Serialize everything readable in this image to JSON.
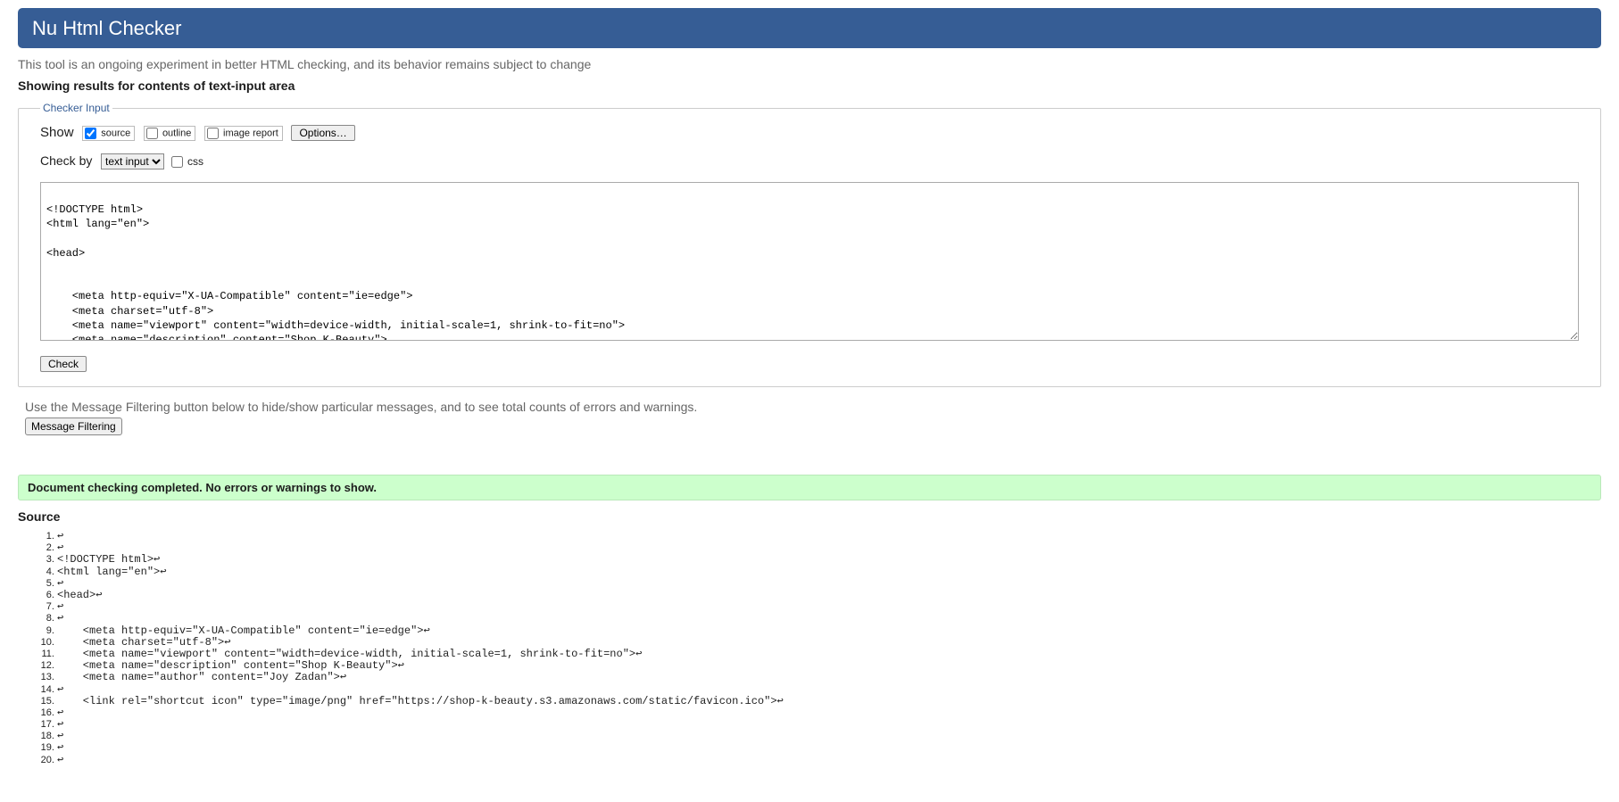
{
  "header": {
    "title": "Nu Html Checker"
  },
  "intro": "This tool is an ongoing experiment in better HTML checking, and its behavior remains subject to change",
  "results_for": "Showing results for contents of text-input area",
  "checker": {
    "legend": "Checker Input",
    "show_label": "Show",
    "source_label": "source",
    "outline_label": "outline",
    "image_report_label": "image report",
    "options_label": "Options…",
    "check_by_label": "Check by",
    "check_by_value": "text input",
    "css_label": "css",
    "textarea_value": "\n<!DOCTYPE html>\n<html lang=\"en\">\n\n<head>\n\n\n    <meta http-equiv=\"X-UA-Compatible\" content=\"ie=edge\">\n    <meta charset=\"utf-8\">\n    <meta name=\"viewport\" content=\"width=device-width, initial-scale=1, shrink-to-fit=no\">\n    <meta name=\"description\" content=\"Shop K-Beauty\">\n    <meta name=\"author\" content=\"Joy Zadan\">\n\n    <link rel=\"shortcut icon\" type=\"image/png\" href=\"https://shop-k-beauty.s3.amazonaws.com/static/favicon.ico\">",
    "check_button": "Check"
  },
  "filter_hint": "Use the Message Filtering button below to hide/show particular messages, and to see total counts of errors and warnings.",
  "filter_button": "Message Filtering",
  "success": "Document checking completed. No errors or warnings to show.",
  "source_heading": "Source",
  "source_lines": [
    "↩",
    "↩",
    "<!DOCTYPE html>↩",
    "<html lang=\"en\">↩",
    "↩",
    "<head>↩",
    "↩",
    "↩",
    "    <meta http-equiv=\"X-UA-Compatible\" content=\"ie=edge\">↩",
    "    <meta charset=\"utf-8\">↩",
    "    <meta name=\"viewport\" content=\"width=device-width, initial-scale=1, shrink-to-fit=no\">↩",
    "    <meta name=\"description\" content=\"Shop K-Beauty\">↩",
    "    <meta name=\"author\" content=\"Joy Zadan\">↩",
    "↩",
    "    <link rel=\"shortcut icon\" type=\"image/png\" href=\"https://shop-k-beauty.s3.amazonaws.com/static/favicon.ico\">↩",
    "↩",
    "↩",
    "↩",
    "↩",
    "↩"
  ]
}
